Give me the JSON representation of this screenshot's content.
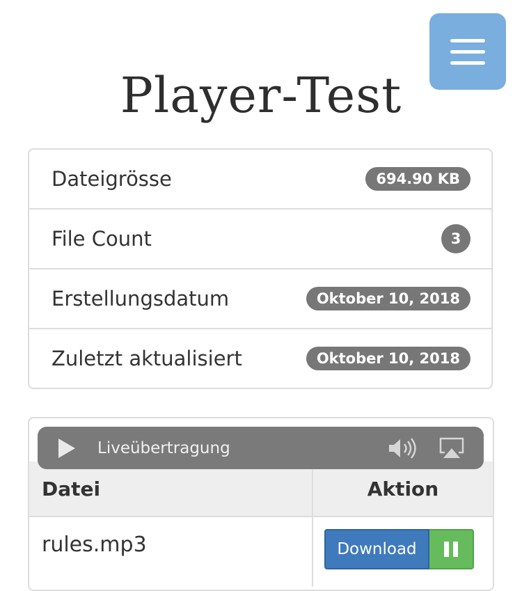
{
  "menu": {
    "icon": "hamburger-icon"
  },
  "page": {
    "title": "Player-Test"
  },
  "info": {
    "items": [
      {
        "label": "Dateigrösse",
        "value": "694.90 KB"
      },
      {
        "label": "File Count",
        "value": "3"
      },
      {
        "label": "Erstellungsdatum",
        "value": "Oktober 10, 2018"
      },
      {
        "label": "Zuletzt aktualisiert",
        "value": "Oktober 10, 2018"
      }
    ]
  },
  "player": {
    "status": "Liveübertragung",
    "play_icon": "play-icon",
    "volume_icon": "volume-icon",
    "airplay_icon": "airplay-icon"
  },
  "table": {
    "headers": {
      "file": "Datei",
      "action": "Aktion"
    },
    "rows": [
      {
        "file": "rules.mp3",
        "download_label": "Download",
        "pause_icon": "pause-icon"
      }
    ]
  },
  "colors": {
    "menu_bg": "#7aaede",
    "badge_bg": "#777777",
    "download_bg": "#3f7abd",
    "pause_bg": "#66bb5c",
    "player_bg": "#7a7a7a"
  }
}
